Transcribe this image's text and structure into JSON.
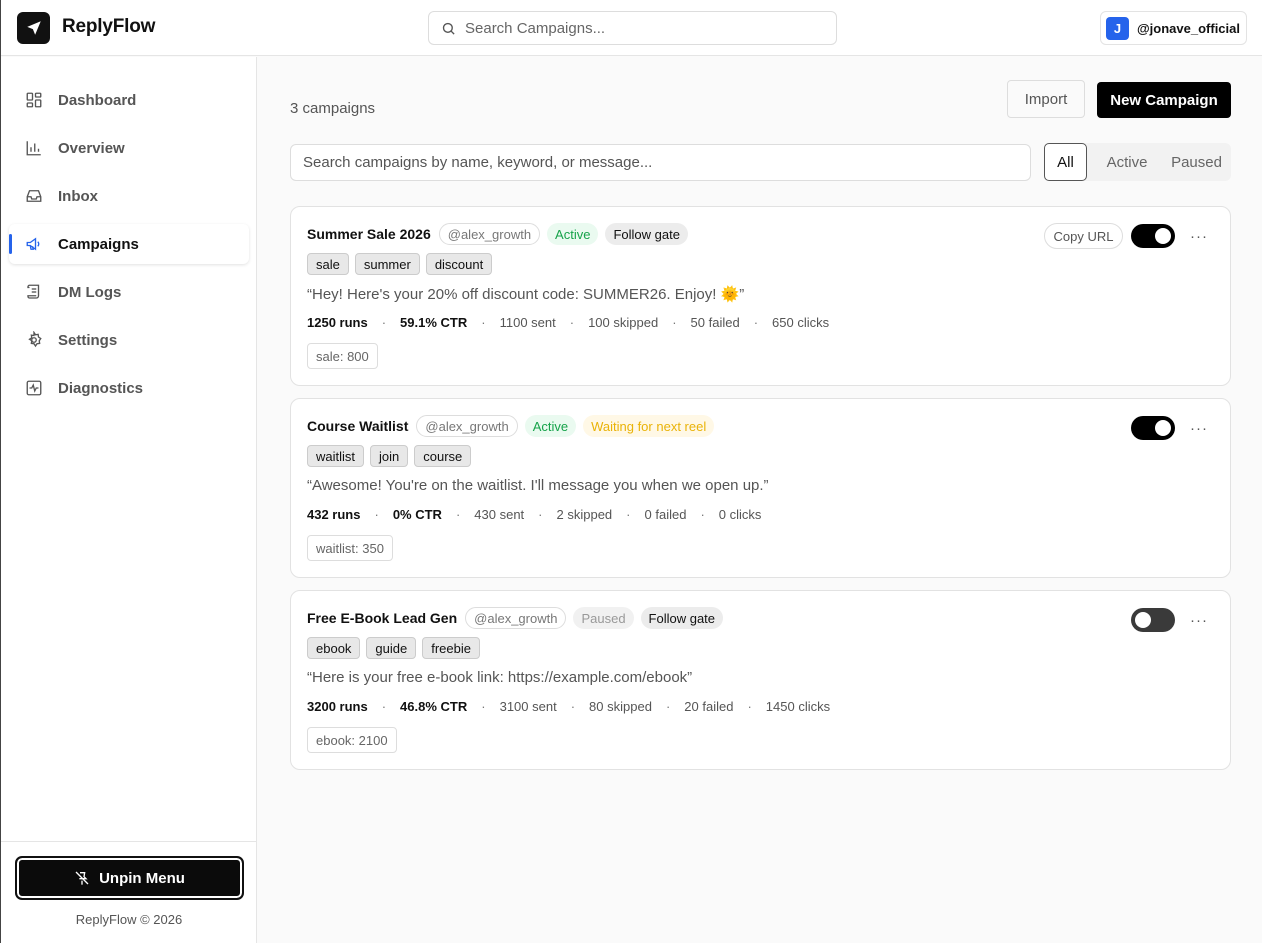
{
  "app": {
    "brand": "ReplyFlow",
    "search_placeholder": "Search Campaigns...",
    "user_initial": "J",
    "user_handle": "@jonave_official"
  },
  "sidebar": {
    "items": [
      {
        "label": "Dashboard",
        "icon": "dashboard-icon"
      },
      {
        "label": "Overview",
        "icon": "bar-chart-icon"
      },
      {
        "label": "Inbox",
        "icon": "inbox-icon"
      },
      {
        "label": "Campaigns",
        "icon": "megaphone-icon",
        "active": true
      },
      {
        "label": "DM Logs",
        "icon": "scroll-icon"
      },
      {
        "label": "Settings",
        "icon": "gear-icon"
      },
      {
        "label": "Diagnostics",
        "icon": "activity-icon"
      }
    ],
    "unpin_label": "Unpin Menu",
    "copyright": "ReplyFlow © 2026"
  },
  "main": {
    "count_label": "3 campaigns",
    "import_label": "Import",
    "new_label": "New Campaign",
    "filter_placeholder": "Search campaigns by name, keyword, or message...",
    "filters": [
      "All",
      "Active",
      "Paused"
    ],
    "active_filter": "All"
  },
  "campaigns": [
    {
      "title": "Summer Sale 2026",
      "account": "@alex_growth",
      "status": "Active",
      "gate": "Follow gate",
      "keywords": [
        "sale",
        "summer",
        "discount"
      ],
      "message": "“Hey! Here's your 20% off discount code: SUMMER26. Enjoy! 🌞”",
      "runs": "1250 runs",
      "ctr": "59.1% CTR",
      "sent": "1100 sent",
      "skipped": "100 skipped",
      "failed": "50 failed",
      "clicks": "650 clicks",
      "breakdown": "sale: 800",
      "copy_url": "Copy URL",
      "enabled": true
    },
    {
      "title": "Course Waitlist",
      "account": "@alex_growth",
      "status": "Active",
      "gate": "Waiting for next reel",
      "keywords": [
        "waitlist",
        "join",
        "course"
      ],
      "message": "“Awesome! You're on the waitlist. I'll message you when we open up.”",
      "runs": "432 runs",
      "ctr": "0% CTR",
      "sent": "430 sent",
      "skipped": "2 skipped",
      "failed": "0 failed",
      "clicks": "0 clicks",
      "breakdown": "waitlist: 350",
      "enabled": true
    },
    {
      "title": "Free E-Book Lead Gen",
      "account": "@alex_growth",
      "status": "Paused",
      "gate": "Follow gate",
      "keywords": [
        "ebook",
        "guide",
        "freebie"
      ],
      "message": "“Here is your free e-book link: https://example.com/ebook”",
      "runs": "3200 runs",
      "ctr": "46.8% CTR",
      "sent": "3100 sent",
      "skipped": "80 skipped",
      "failed": "20 failed",
      "clicks": "1450 clicks",
      "breakdown": "ebook: 2100",
      "enabled": false
    }
  ],
  "colors": {
    "accent": "#2563eb",
    "active_status": "#16a34a",
    "waiting_status": "#eab308",
    "primary_button": "#000000"
  }
}
